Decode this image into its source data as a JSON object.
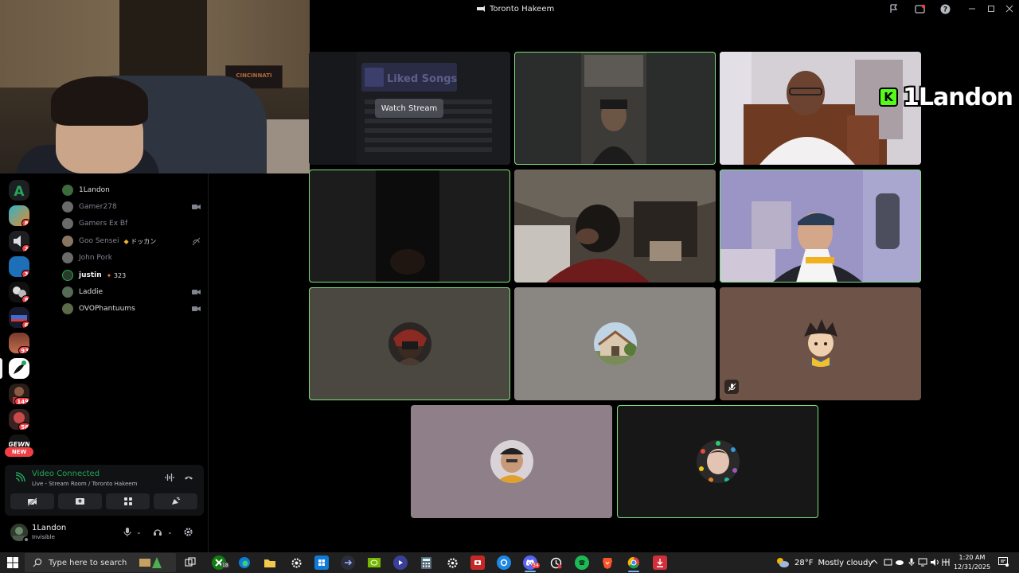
{
  "window": {
    "title": "Toronto Hakeem"
  },
  "colors": {
    "speaking_outline": "#7ae17a",
    "connected_green": "#23a55a",
    "badge_red": "#f23f43",
    "kick_green": "#53fc18"
  },
  "server_rail": {
    "items": [
      {
        "name": "server-a",
        "badge": ""
      },
      {
        "name": "server-1",
        "badge": "8"
      },
      {
        "name": "server-2",
        "badge": "2"
      },
      {
        "name": "server-3",
        "badge": "3"
      },
      {
        "name": "server-4",
        "badge": "8"
      },
      {
        "name": "server-5",
        "badge": "6"
      },
      {
        "name": "server-6",
        "badge": "93"
      },
      {
        "name": "server-7",
        "badge": ""
      },
      {
        "name": "server-8",
        "badge": "149"
      },
      {
        "name": "server-9",
        "badge": "56"
      }
    ],
    "new_label": "NEW"
  },
  "members": [
    {
      "name": "1Landon",
      "style": "live",
      "tag": "",
      "icon": ""
    },
    {
      "name": "Gamer278",
      "style": "dim",
      "tag": "",
      "icon": "video-icon"
    },
    {
      "name": "Gamers Ex Bf",
      "style": "dim",
      "tag": "",
      "icon": ""
    },
    {
      "name": "Goo Sensei",
      "style": "dim",
      "tag": "ドッカン",
      "icon": "deafen-icon"
    },
    {
      "name": "John Pork",
      "style": "dim",
      "tag": "",
      "icon": ""
    },
    {
      "name": "justin",
      "style": "bold",
      "tag": "323",
      "icon": ""
    },
    {
      "name": "Laddie",
      "style": "live",
      "tag": "",
      "icon": "video-icon"
    },
    {
      "name": "OVOPhantuums",
      "style": "live",
      "tag": "",
      "icon": "video-icon"
    }
  ],
  "voice": {
    "status": "Video Connected",
    "channel": "Live - Stream Room / Toronto Hakeem"
  },
  "user": {
    "name": "1Landon",
    "status": "Invisible"
  },
  "grid": {
    "watch_stream_label": "Watch Stream",
    "stream_preview_text": "Liked Songs"
  },
  "webcam": {
    "banner_text": "CINCINNATI"
  },
  "sticker": {
    "letter": "K",
    "text": "1Landon"
  },
  "taskbar": {
    "search_placeholder": "Type here to search",
    "weather_temp": "28°F",
    "weather_desc": "Mostly cloudy",
    "time": "1:20 AM",
    "date": "12/31/2025",
    "xbox_badge": "18",
    "discord_badge": "34"
  }
}
